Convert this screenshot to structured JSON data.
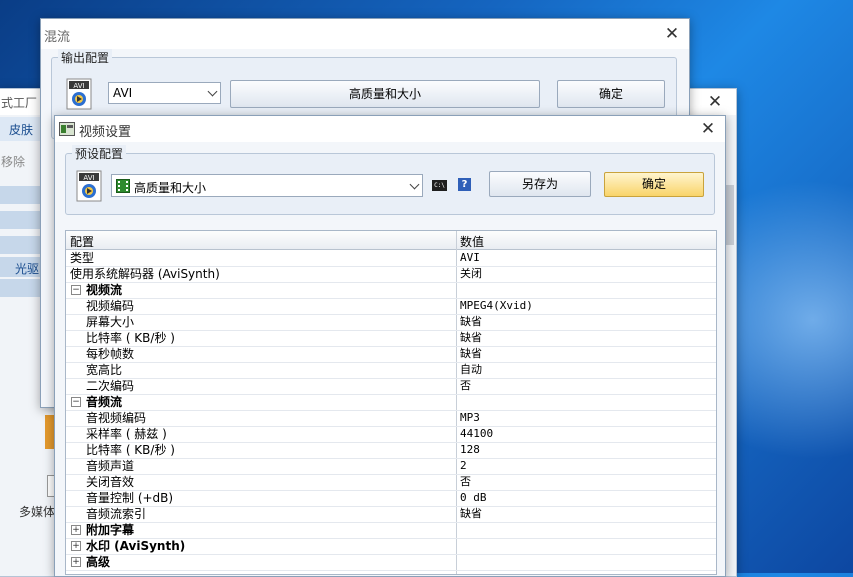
{
  "back_window": {
    "title_fragment": "式工厂 2",
    "skin_label": "皮肤",
    "remove_label": "移除",
    "optical_label": "光驱",
    "multimedia_label": "多媒体"
  },
  "mix_window": {
    "title": "混流",
    "output_group_title": "输出配置",
    "format_value": "AVI",
    "quality_button": "高质量和大小",
    "ok_button": "确定"
  },
  "video_dialog": {
    "title": "视频设置",
    "preset_group_title": "预设配置",
    "preset_value": "高质量和大小",
    "cmd_icon_text": "C:\\",
    "help_icon_text": "?",
    "save_as_button": "另存为",
    "ok_button": "确定"
  },
  "avi_icon_text": "AVI",
  "grid": {
    "headers": {
      "name": "配置",
      "value": "数值"
    },
    "rows": [
      {
        "name": "类型",
        "value": "AVI"
      },
      {
        "name": "使用系统解码器 (AviSynth)",
        "value": "关闭"
      },
      {
        "name": "视频流",
        "value": ""
      },
      {
        "name": "视频编码",
        "value": "MPEG4(Xvid)"
      },
      {
        "name": "屏幕大小",
        "value": "缺省"
      },
      {
        "name": "比特率 ( KB/秒 )",
        "value": "缺省"
      },
      {
        "name": "每秒帧数",
        "value": "缺省"
      },
      {
        "name": "宽高比",
        "value": "自动"
      },
      {
        "name": "二次编码",
        "value": "否"
      },
      {
        "name": "音频流",
        "value": ""
      },
      {
        "name": "音视频编码",
        "value": "MP3"
      },
      {
        "name": "采样率 ( 赫兹 )",
        "value": "44100"
      },
      {
        "name": "比特率 ( KB/秒 )",
        "value": "128"
      },
      {
        "name": "音频声道",
        "value": "2"
      },
      {
        "name": "关闭音效",
        "value": "否"
      },
      {
        "name": "音量控制 (+dB)",
        "value": "0 dB"
      },
      {
        "name": "音频流索引",
        "value": "缺省"
      },
      {
        "name": "附加字幕",
        "value": ""
      },
      {
        "name": "水印 (AviSynth)",
        "value": ""
      },
      {
        "name": "高级",
        "value": ""
      }
    ],
    "expanded_symbol": "−",
    "collapsed_symbol": "+"
  }
}
